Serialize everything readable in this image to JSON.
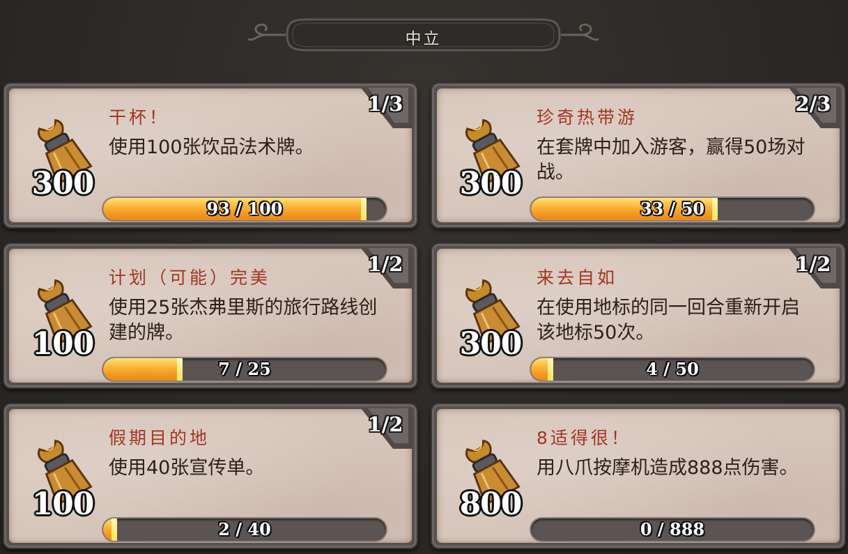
{
  "header": {
    "title": "中立"
  },
  "achievements": [
    {
      "title": "干杯！",
      "description": "使用100张饮品法术牌。",
      "reward": "300",
      "tier": "1/3",
      "progress_text": "93 / 100",
      "progress": 0.93
    },
    {
      "title": "珍奇热带游",
      "description": "在套牌中加入游客，赢得50场对战。",
      "reward": "300",
      "tier": "2/3",
      "progress_text": "33 / 50",
      "progress": 0.66
    },
    {
      "title": "计划（可能）完美",
      "description": "使用25张杰弗里斯的旅行路线创建的牌。",
      "reward": "100",
      "tier": "1/2",
      "progress_text": "7 / 25",
      "progress": 0.28
    },
    {
      "title": "来去自如",
      "description": "在使用地标的同一回合重新开启该地标50次。",
      "reward": "300",
      "tier": "1/2",
      "progress_text": "4 / 50",
      "progress": 0.08
    },
    {
      "title": "假期目的地",
      "description": "使用40张宣传单。",
      "reward": "100",
      "tier": "1/2",
      "progress_text": "2 / 40",
      "progress": 0.05
    },
    {
      "title": "8适得很！",
      "description": "用八爪按摩机造成888点伤害。",
      "reward": "800",
      "tier": "",
      "progress_text": "0 / 888",
      "progress": 0.0
    }
  ],
  "icons": {
    "reward": "card-pack-icon",
    "tier": "tier-banner-icon"
  },
  "colors": {
    "title": "#a3361f",
    "bar_fill": "#f7a92b",
    "card_bg": "#d7c6bb"
  }
}
